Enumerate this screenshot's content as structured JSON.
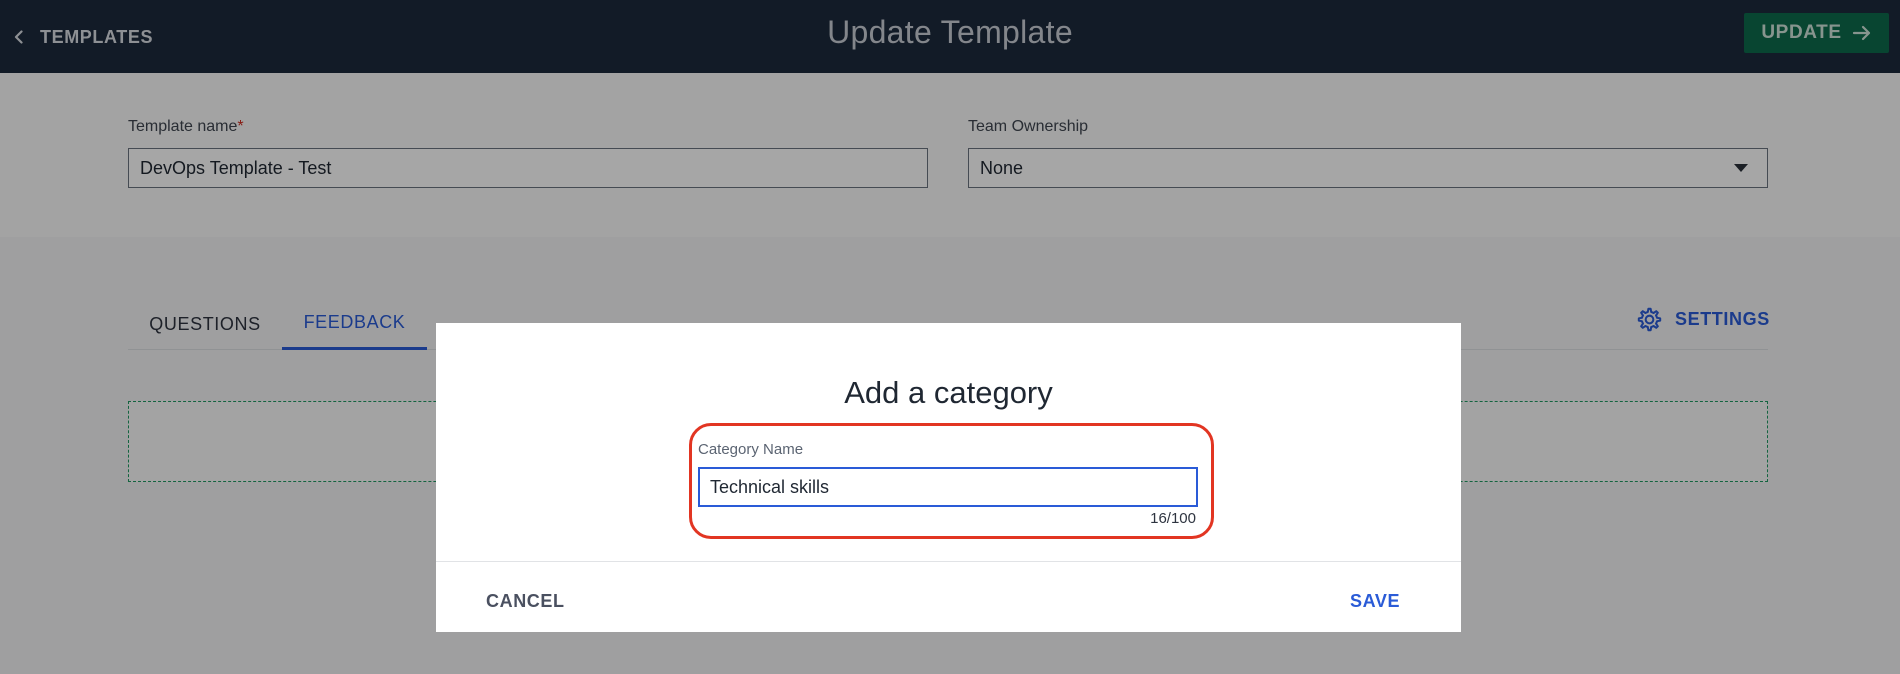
{
  "header": {
    "back_label": "TEMPLATES",
    "title": "Update Template",
    "update_label": "UPDATE"
  },
  "form": {
    "template_name_label": "Template name",
    "template_name_required": "*",
    "template_name_value": "DevOps Template - Test",
    "team_ownership_label": "Team Ownership",
    "team_ownership_value": "None"
  },
  "tabs": [
    {
      "label": "QUESTIONS",
      "active": false
    },
    {
      "label": "FEEDBACK",
      "active": true
    }
  ],
  "settings_label": "SETTINGS",
  "modal": {
    "title": "Add a category",
    "category_label": "Category Name",
    "category_value": "Technical skills",
    "counter": "16/100",
    "cancel_label": "CANCEL",
    "save_label": "SAVE"
  },
  "colors": {
    "header_bg": "#1d2a3c",
    "update_bg": "#0d6b4c",
    "accent": "#2a5bd7",
    "highlight": "#e23522",
    "dropzone_border": "#1f9a63"
  }
}
